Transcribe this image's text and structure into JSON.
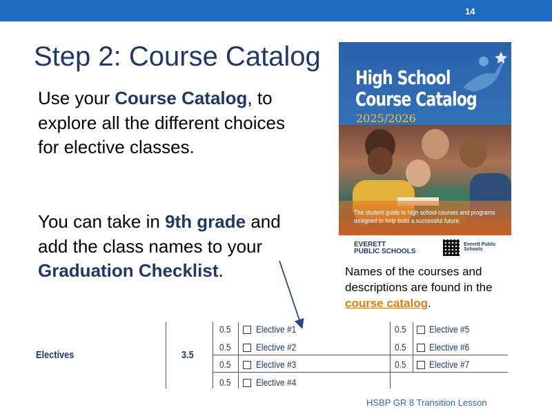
{
  "slide": {
    "number": "14",
    "title": "Step 2: Course Catalog"
  },
  "text": {
    "p1_a": "Use your ",
    "p1_b": "Course Catalog",
    "p1_c": ", to explore  all the different choices for elective classes.",
    "p2_a": "You can take in ",
    "p2_b": "9th grade",
    "p2_c": " and add the class names to your ",
    "p2_d": "Graduation Checklist",
    "p2_e": "."
  },
  "cover": {
    "title_line1": "High School",
    "title_line2": "Course Catalog",
    "year": "2025/2026",
    "tagline_line1": "The student guide to high school courses and programs",
    "tagline_line2": "designed to help build a successful future.",
    "logo_line1": "EVERETT",
    "logo_line2": "PUBLIC SCHOOLS",
    "eps_text": "Everett Public Schools"
  },
  "caption": {
    "text": "Names of the courses and descriptions are found in the ",
    "link": "course catalog",
    "end": "."
  },
  "checklist": {
    "label": "Electives",
    "credits": "3.5",
    "left_items": [
      {
        "credit": "0.5",
        "label": "Elective #1"
      },
      {
        "credit": "0.5",
        "label": "Elective #2"
      },
      {
        "credit": "0.5",
        "label": "Elective #3"
      },
      {
        "credit": "0.5",
        "label": "Elective #4"
      }
    ],
    "right_items": [
      {
        "credit": "0.5",
        "label": "Elective #5"
      },
      {
        "credit": "0.5",
        "label": "Elective #6"
      },
      {
        "credit": "0.5",
        "label": "Elective #7"
      }
    ]
  },
  "footer": "HSBP GR 8 Transition  Lesson",
  "colors": {
    "topbar": "#1f6bc1",
    "title": "#1f3864",
    "accent_orange": "#e07b14"
  }
}
